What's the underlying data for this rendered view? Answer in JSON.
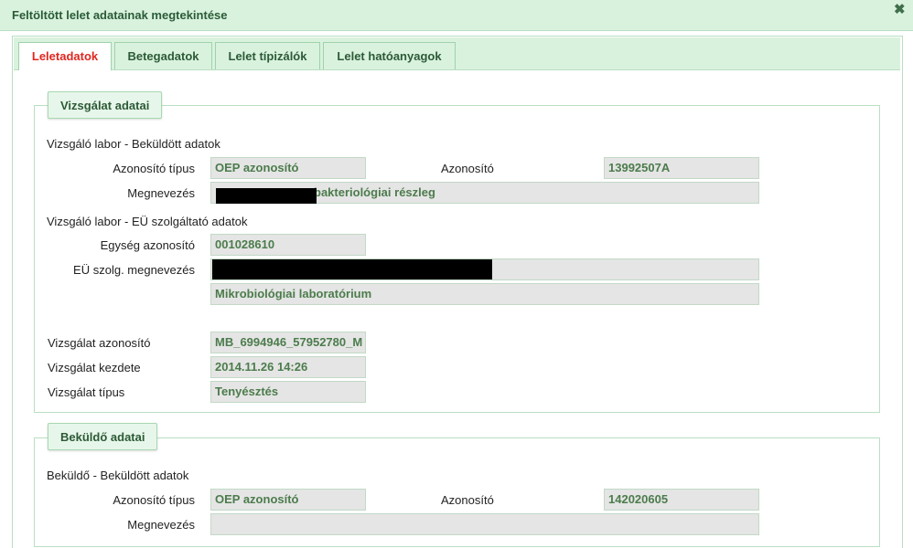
{
  "window": {
    "title": "Feltöltött lelet adatainak megtekintése",
    "close_glyph": "✖"
  },
  "tabs": [
    {
      "label": "Leletadatok",
      "active": true
    },
    {
      "label": "Betegadatok",
      "active": false
    },
    {
      "label": "Lelet típizálók",
      "active": false
    },
    {
      "label": "Lelet hatóanyagok",
      "active": false
    }
  ],
  "vizsgalat": {
    "legend": "Vizsgálat adatai",
    "sent_heading": "Vizsgáló labor - Beküldött adatok",
    "id_type_label": "Azonosító típus",
    "id_type_value": "OEP azonosító",
    "id_label": "Azonosító",
    "id_value": "13992507A",
    "name_label": "Megnevezés",
    "name_value": "bakteriológiai részleg",
    "eu_heading": "Vizsgáló labor - EÜ szolgáltató adatok",
    "unit_id_label": "Egység azonosító",
    "unit_id_value": "001028610",
    "eu_name_label": "EÜ szolg. megnevezés",
    "eu_name_value": "",
    "eu_name_value2": "Mikrobiológiai laboratórium",
    "exam_id_label": "Vizsgálat azonosító",
    "exam_id_value": "MB_6994946_57952780_M",
    "exam_start_label": "Vizsgálat kezdete",
    "exam_start_value": "2014.11.26 14:26",
    "exam_type_label": "Vizsgálat típus",
    "exam_type_value": "Tenyésztés"
  },
  "bekuldo": {
    "legend": "Beküldő adatai",
    "sent_heading": "Beküldő - Beküldött adatok",
    "id_type_label": "Azonosító típus",
    "id_type_value": "OEP azonosító",
    "id_label": "Azonosító",
    "id_value": "142020605",
    "name_label": "Megnevezés",
    "name_value": ""
  },
  "colors": {
    "header_bg": "#d9f2de",
    "border": "#b9dfc2",
    "active_tab_text": "#e0261f",
    "field_bg": "#e5e5e5",
    "field_text": "#4c7c4c",
    "redaction": "#000000"
  }
}
